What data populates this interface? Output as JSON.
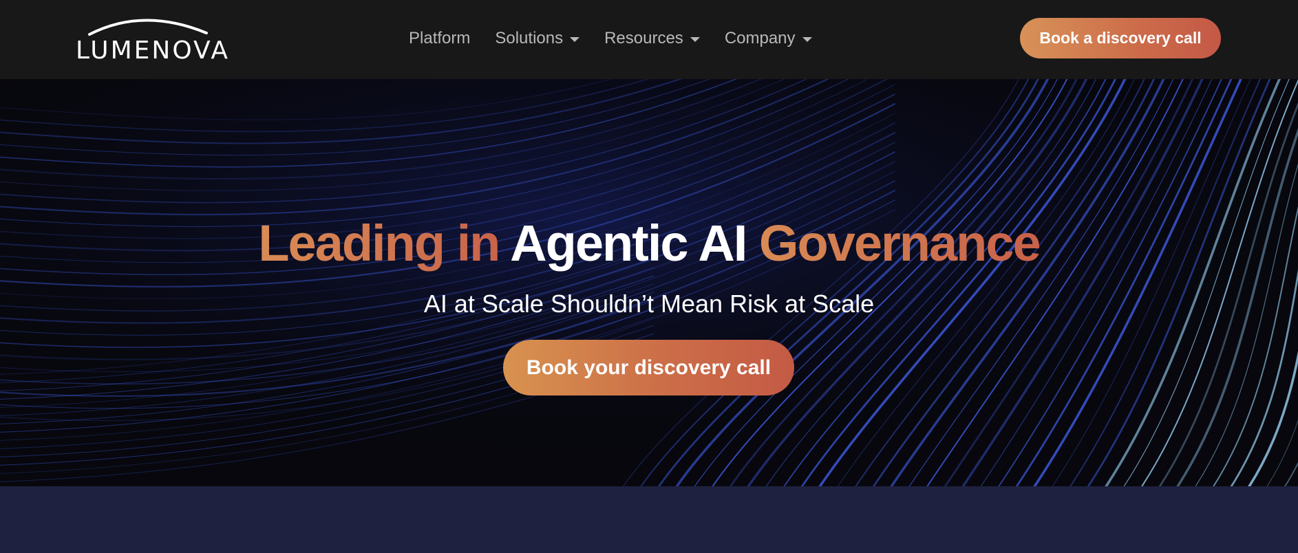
{
  "logo": {
    "text": "LUMENOVA"
  },
  "nav": {
    "items": [
      {
        "label": "Platform",
        "has_dropdown": false
      },
      {
        "label": "Solutions",
        "has_dropdown": true
      },
      {
        "label": "Resources",
        "has_dropdown": true
      },
      {
        "label": "Company",
        "has_dropdown": true
      }
    ],
    "cta_label": "Book a discovery call"
  },
  "hero": {
    "title_part1": "Leading in ",
    "title_part2": "Agentic AI",
    "title_part3": " Governance",
    "subtitle": "AI at Scale Shouldn’t Mean Risk at Scale",
    "cta_label": "Book your discovery call"
  },
  "colors": {
    "accent_start": "#d8924f",
    "accent_end": "#c45a45",
    "nav_bg": "#181818",
    "hero_bg": "#07070d",
    "section_bg": "#1f2140",
    "nav_text": "#b9b9bd",
    "streak_blue": "#3b57d6",
    "streak_light": "#8fc4e6"
  }
}
